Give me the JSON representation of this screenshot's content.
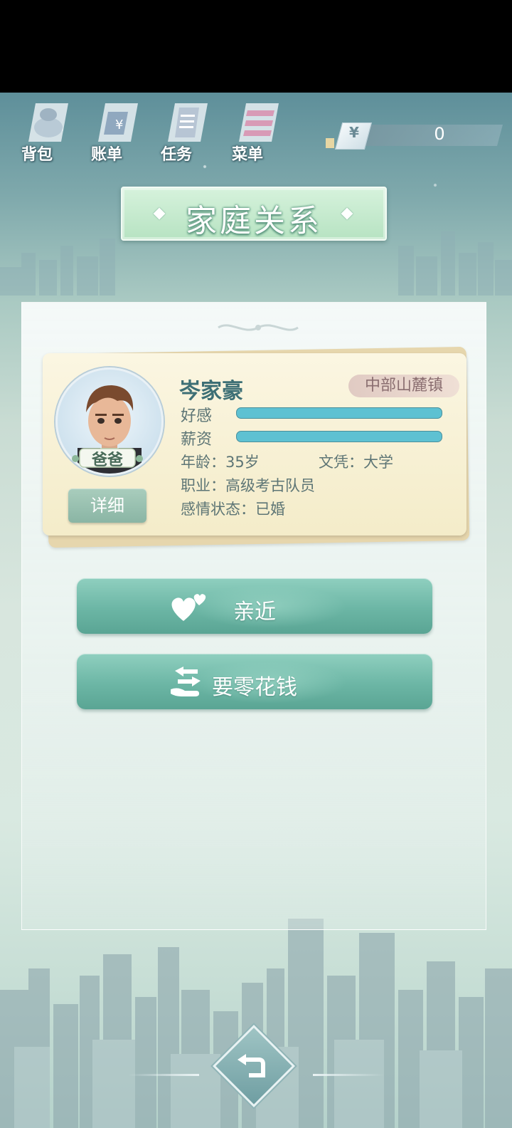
{
  "nav": {
    "items": [
      {
        "id": "bag",
        "label": "背包",
        "icon": "bag-icon"
      },
      {
        "id": "bill",
        "label": "账单",
        "icon": "bill-icon"
      },
      {
        "id": "task",
        "label": "任务",
        "icon": "task-icon"
      },
      {
        "id": "menu",
        "label": "菜单",
        "icon": "menu-icon"
      }
    ]
  },
  "money": {
    "symbol": "¥",
    "value": "0"
  },
  "title": "家庭关系",
  "character": {
    "name": "岑家豪",
    "role": "爸爸",
    "location": "中部山麓镇",
    "favor_label": "好感",
    "favor_level": 1.0,
    "salary_label": "薪资",
    "salary_level": 1.0,
    "age": "年龄：35岁",
    "education": "文凭：大学",
    "job": "职业：高级考古队员",
    "relationship": "感情状态：已婚",
    "detail_button": "详细"
  },
  "actions": [
    {
      "label": "亲近",
      "icon": "hearts-icon"
    },
    {
      "label": "要零花钱",
      "icon": "exchange-hand-icon"
    }
  ],
  "colors": {
    "bar": "#5ec1d2",
    "button": "#6cb6a5",
    "name": "#3d6f75"
  }
}
